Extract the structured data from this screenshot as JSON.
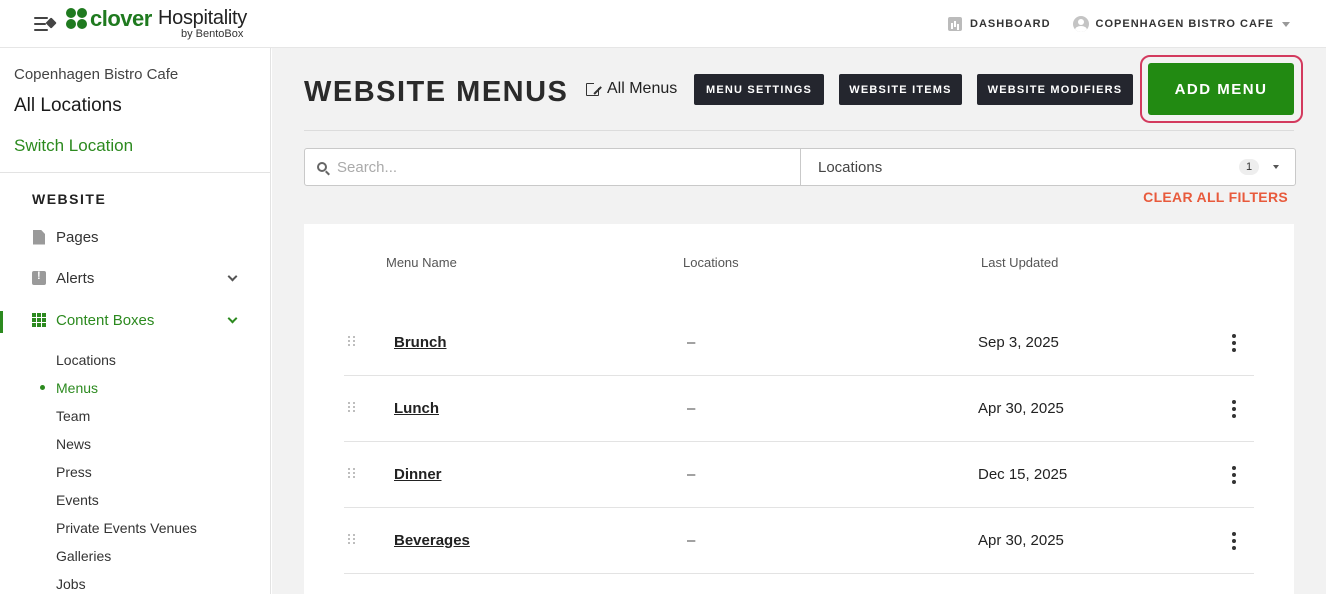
{
  "header": {
    "logo_brand": "clover",
    "logo_product": "Hospitality",
    "logo_sub": "by BentoBox",
    "dashboard_label": "DASHBOARD",
    "location_label": "COPENHAGEN BISTRO CAFE",
    "icons": [
      "menu-collapse-icon",
      "clover-logo-icon",
      "dashboard-icon",
      "user-icon",
      "caret-down-icon"
    ]
  },
  "sidebar": {
    "business_name": "Copenhagen Bistro Cafe",
    "all_locations": "All Locations",
    "switch_location": "Switch Location",
    "section_title": "WEBSITE",
    "items": [
      {
        "label": "Pages",
        "icon": "page-icon"
      },
      {
        "label": "Alerts",
        "icon": "alert-icon"
      },
      {
        "label": "Content Boxes",
        "icon": "grid-icon"
      }
    ],
    "subitems": [
      "Locations",
      "Menus",
      "Team",
      "News",
      "Press",
      "Events",
      "Private Events Venues",
      "Galleries",
      "Jobs"
    ],
    "active_subitem": "Menus"
  },
  "main": {
    "title": "WEBSITE MENUS",
    "all_menus_link": "All Menus",
    "buttons": {
      "menu_settings": "MENU SETTINGS",
      "website_items": "WEBSITE ITEMS",
      "website_modifiers": "WEBSITE MODIFIERS",
      "add_menu": "ADD MENU"
    },
    "search_placeholder": "Search...",
    "locations_filter_label": "Locations",
    "locations_filter_count": "1",
    "clear_filters": "CLEAR ALL FILTERS",
    "table": {
      "headers": [
        "Menu Name",
        "Locations",
        "Last Updated"
      ],
      "rows": [
        {
          "name": "Brunch",
          "locations": "–",
          "updated": "Sep 3, 2025"
        },
        {
          "name": "Lunch",
          "locations": "–",
          "updated": "Apr 30, 2025"
        },
        {
          "name": "Dinner",
          "locations": "–",
          "updated": "Dec 15, 2025"
        },
        {
          "name": "Beverages",
          "locations": "–",
          "updated": "Apr 30, 2025"
        }
      ]
    }
  },
  "colors": {
    "brand_green": "#228a12",
    "highlight_ring": "#d33a5e",
    "clear_filters": "#e85a3c",
    "dark_button": "#24262e"
  }
}
